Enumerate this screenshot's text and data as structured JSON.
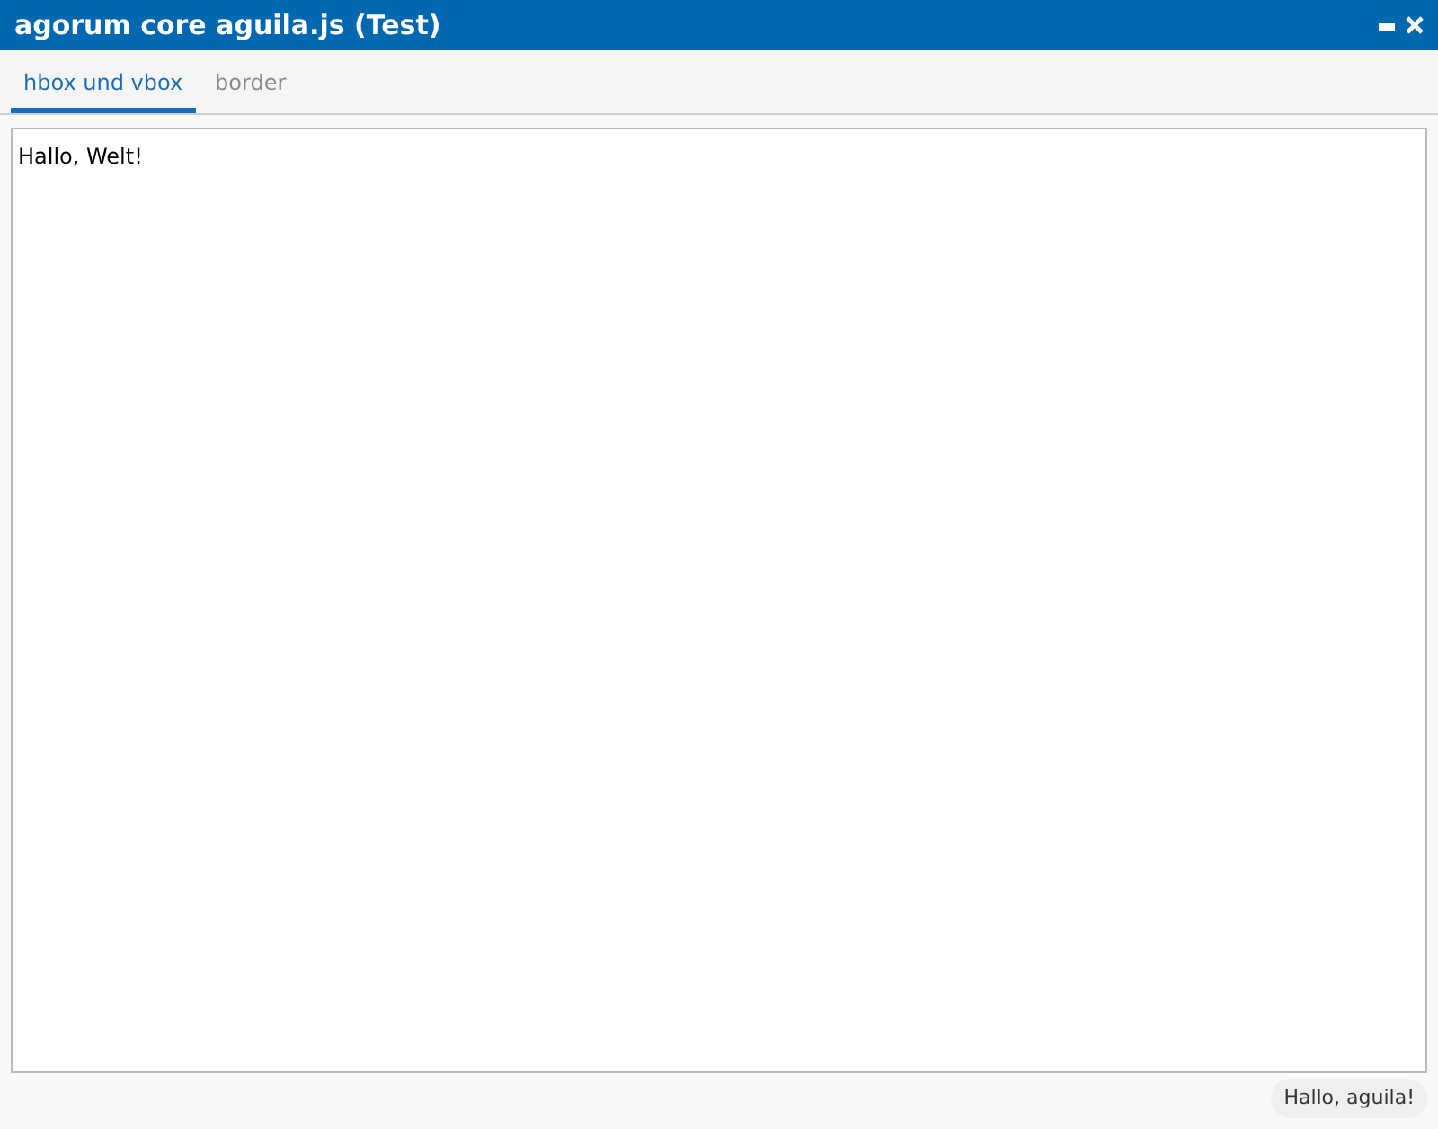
{
  "window": {
    "title": "agorum core aguila.js (Test)"
  },
  "tabs": [
    {
      "label": "hbox und vbox",
      "selected": true
    },
    {
      "label": "border",
      "selected": false
    }
  ],
  "content": {
    "text": "Hallo, Welt!"
  },
  "status": {
    "badge": "Hallo, aguila!"
  }
}
